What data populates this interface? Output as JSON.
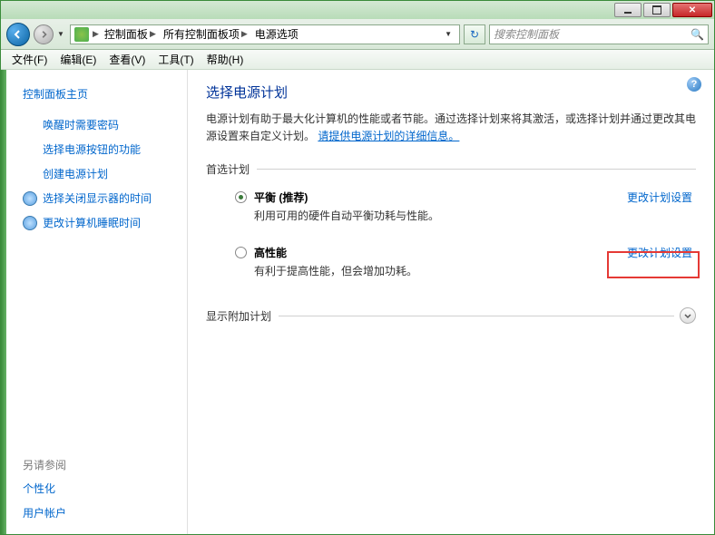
{
  "titlebar": {},
  "navbar": {
    "breadcrumbs": [
      "控制面板",
      "所有控制面板项",
      "电源选项"
    ],
    "search_placeholder": "搜索控制面板"
  },
  "menubar": {
    "items": [
      "文件(F)",
      "编辑(E)",
      "查看(V)",
      "工具(T)",
      "帮助(H)"
    ]
  },
  "sidebar": {
    "home": "控制面板主页",
    "links": [
      {
        "label": "唤醒时需要密码",
        "icon": false
      },
      {
        "label": "选择电源按钮的功能",
        "icon": false
      },
      {
        "label": "创建电源计划",
        "icon": false
      },
      {
        "label": "选择关闭显示器的时间",
        "icon": true
      },
      {
        "label": "更改计算机睡眠时间",
        "icon": true
      }
    ],
    "see_also_label": "另请参阅",
    "see_also": [
      "个性化",
      "用户帐户"
    ]
  },
  "main": {
    "title": "选择电源计划",
    "description_pre": "电源计划有助于最大化计算机的性能或者节能。通过选择计划来将其激活，或选择计划并通过更改其电源设置来自定义计划。",
    "description_link": "请提供电源计划的详细信息。",
    "section_preferred": "首选计划",
    "section_additional": "显示附加计划",
    "plans": [
      {
        "name": "平衡 (推荐)",
        "desc": "利用可用的硬件自动平衡功耗与性能。",
        "checked": true,
        "change": "更改计划设置"
      },
      {
        "name": "高性能",
        "desc": "有利于提高性能，但会增加功耗。",
        "checked": false,
        "change": "更改计划设置"
      }
    ]
  }
}
